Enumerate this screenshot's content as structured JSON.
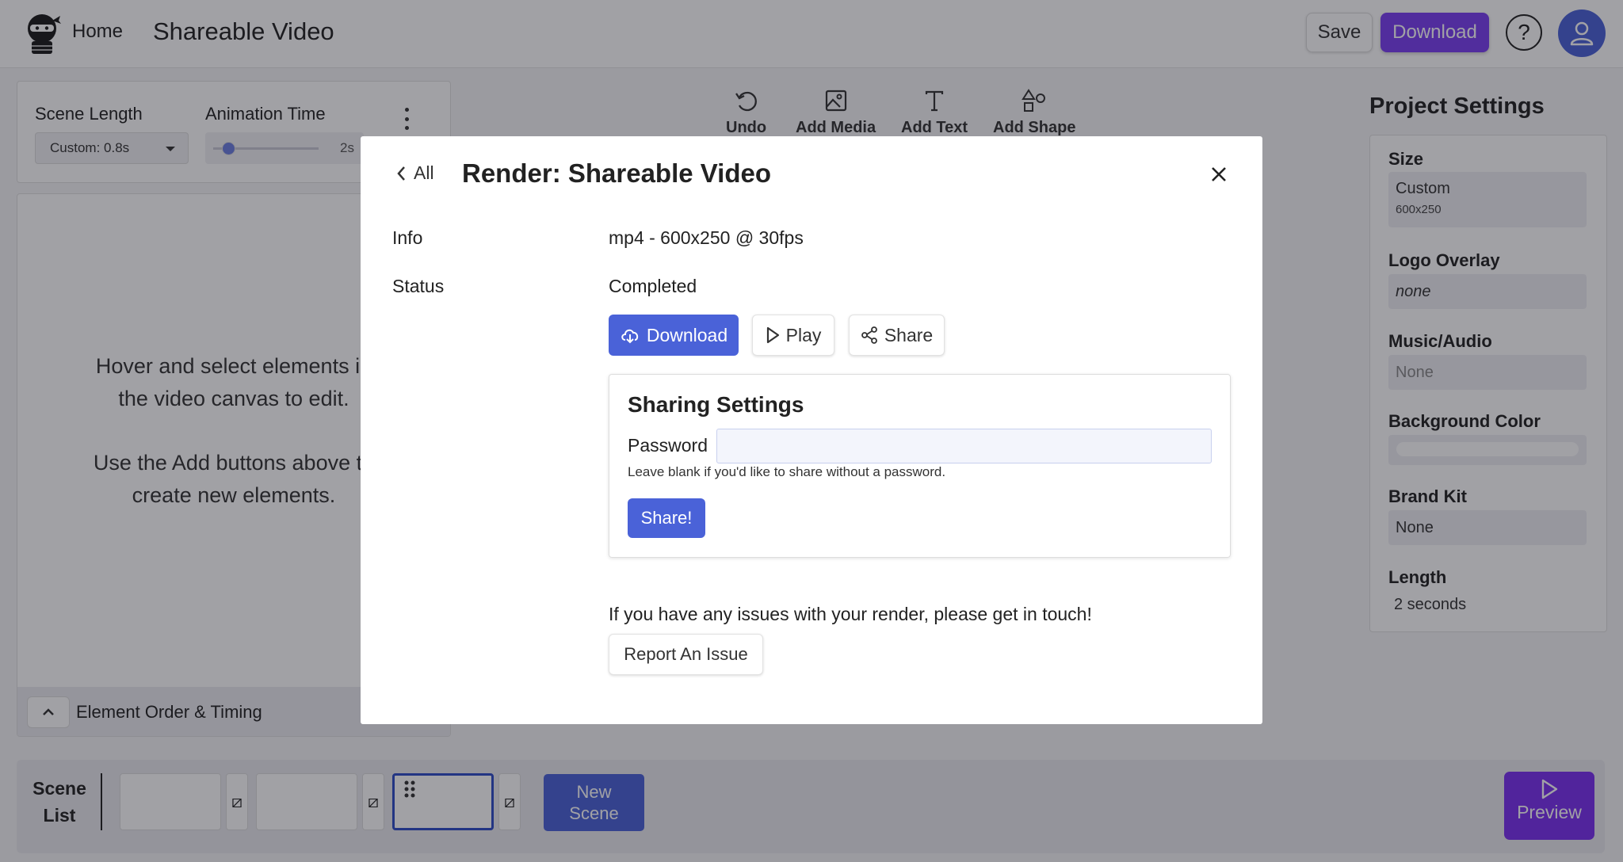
{
  "topbar": {
    "home_label": "Home",
    "project_title": "Shareable Video",
    "save_label": "Save",
    "download_label": "Download",
    "help_glyph": "?",
    "accent_color": "#7b3ff2"
  },
  "scene_settings": {
    "scene_length_label": "Scene Length",
    "scene_length_value": "Custom: 0.8s",
    "animation_time_label": "Animation Time",
    "animation_time_value": "2s",
    "animation_slider_fraction": 0.15
  },
  "canvas_hint": {
    "line1": "Hover and select elements in",
    "line2": "the video canvas to edit.",
    "line3": "Use the Add buttons above to",
    "line4": "create new elements."
  },
  "element_order": {
    "label": "Element Order & Timing"
  },
  "toolbar": {
    "undo_label": "Undo",
    "add_media_label": "Add Media",
    "add_text_label": "Add Text",
    "add_shape_label": "Add Shape"
  },
  "project_settings": {
    "title": "Project Settings",
    "size_label": "Size",
    "size_value": "Custom",
    "size_sub": "600x250",
    "logo_label": "Logo Overlay",
    "logo_value": "none",
    "music_label": "Music/Audio",
    "music_value": "None",
    "bg_label": "Background Color",
    "brand_label": "Brand Kit",
    "brand_value": "None",
    "length_label": "Length",
    "length_value": "2 seconds"
  },
  "scene_list": {
    "label_line1": "Scene",
    "label_line2": "List",
    "transition_glyph": "⧄",
    "new_scene_line1": "New",
    "new_scene_line2": "Scene",
    "preview_label": "Preview"
  },
  "modal": {
    "back_label": "All",
    "title": "Render: Shareable Video",
    "info_label": "Info",
    "info_value": "mp4 - 600x250 @ 30fps",
    "status_label": "Status",
    "status_value": "Completed",
    "download_label": "Download",
    "play_label": "Play",
    "share_label": "Share",
    "sharing_title": "Sharing Settings",
    "password_label": "Password",
    "password_value": "",
    "password_help": "Leave blank if you'd like to share without a password.",
    "share_submit_label": "Share!",
    "issue_text": "If you have any issues with your render, please get in touch!",
    "report_label": "Report An Issue"
  }
}
